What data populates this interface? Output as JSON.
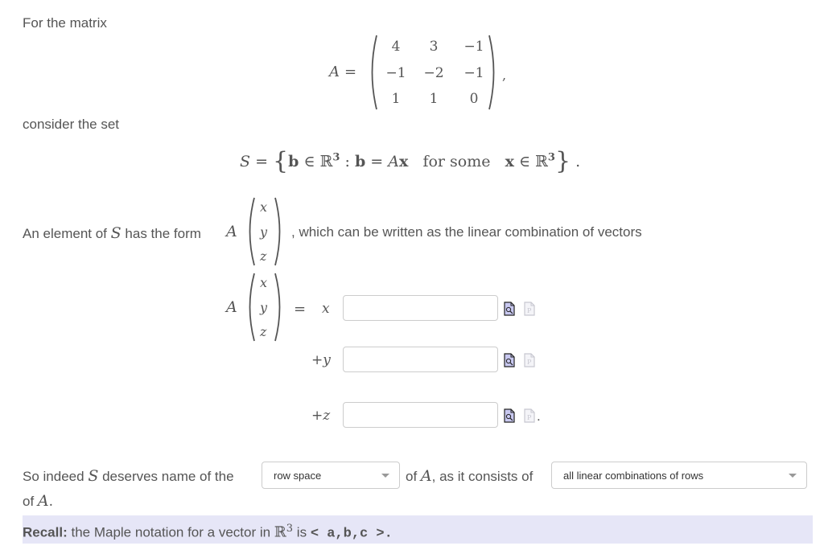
{
  "intro": {
    "for_the_matrix": "For the matrix",
    "consider_the_set": "consider the set"
  },
  "matrix": {
    "name": "A",
    "equals": "=",
    "rows": [
      [
        "4",
        "3",
        "−1"
      ],
      [
        "−1",
        "−2",
        "−1"
      ],
      [
        "1",
        "1",
        "0"
      ]
    ],
    "trailing": ","
  },
  "set_definition": {
    "lhs": "S",
    "equals": "=",
    "open": "{",
    "b": "b",
    "in1": "∈",
    "R": "ℝ",
    "exp1": "3",
    "colon": ":",
    "b2": "b",
    "eq2": "=",
    "A": "A",
    "x": "x",
    "for_some": "for some",
    "x2": "x",
    "in2": "∈",
    "R2": "ℝ",
    "exp2": "3",
    "close": "}",
    "period": "."
  },
  "element_sentence": {
    "prefix": "An element of",
    "S": "S",
    "middle": "has the form",
    "A": "A",
    "vector": [
      "x",
      "y",
      "z"
    ],
    "suffix": ", which can be written as the linear combination of vectors"
  },
  "combination": {
    "A": "A",
    "vector": [
      "x",
      "y",
      "z"
    ],
    "equals": "=",
    "rows": [
      {
        "coef": "x",
        "value": "",
        "placeholder": ""
      },
      {
        "coef": "+y",
        "value": "",
        "placeholder": ""
      },
      {
        "coef": "+z",
        "value": "",
        "placeholder": ""
      }
    ],
    "end_period": "."
  },
  "conclusion": {
    "part1": "So indeed",
    "S": "S",
    "part2": "deserves name of the",
    "select1": {
      "selected": "row space"
    },
    "part3_of": "of",
    "A": "A",
    "part3_rest": ", as it consists of",
    "select2": {
      "selected": "all linear combinations of rows"
    },
    "line2_of": "of",
    "line2_A": "A",
    "line2_period": "."
  },
  "recall": {
    "bold": "Recall:",
    "text": "the Maple notation for a vector in",
    "R": "ℝ",
    "exp": "3",
    "is": "is",
    "notation": "< a,b,c >",
    "period": "."
  },
  "icons": {
    "preview": "preview-icon",
    "paste": "paste-icon"
  },
  "colors": {
    "text": "#555555",
    "recall_bg": "#e6e6f7",
    "preview_icon_fill": "#c8c8f0",
    "input_border": "#cccccc"
  }
}
